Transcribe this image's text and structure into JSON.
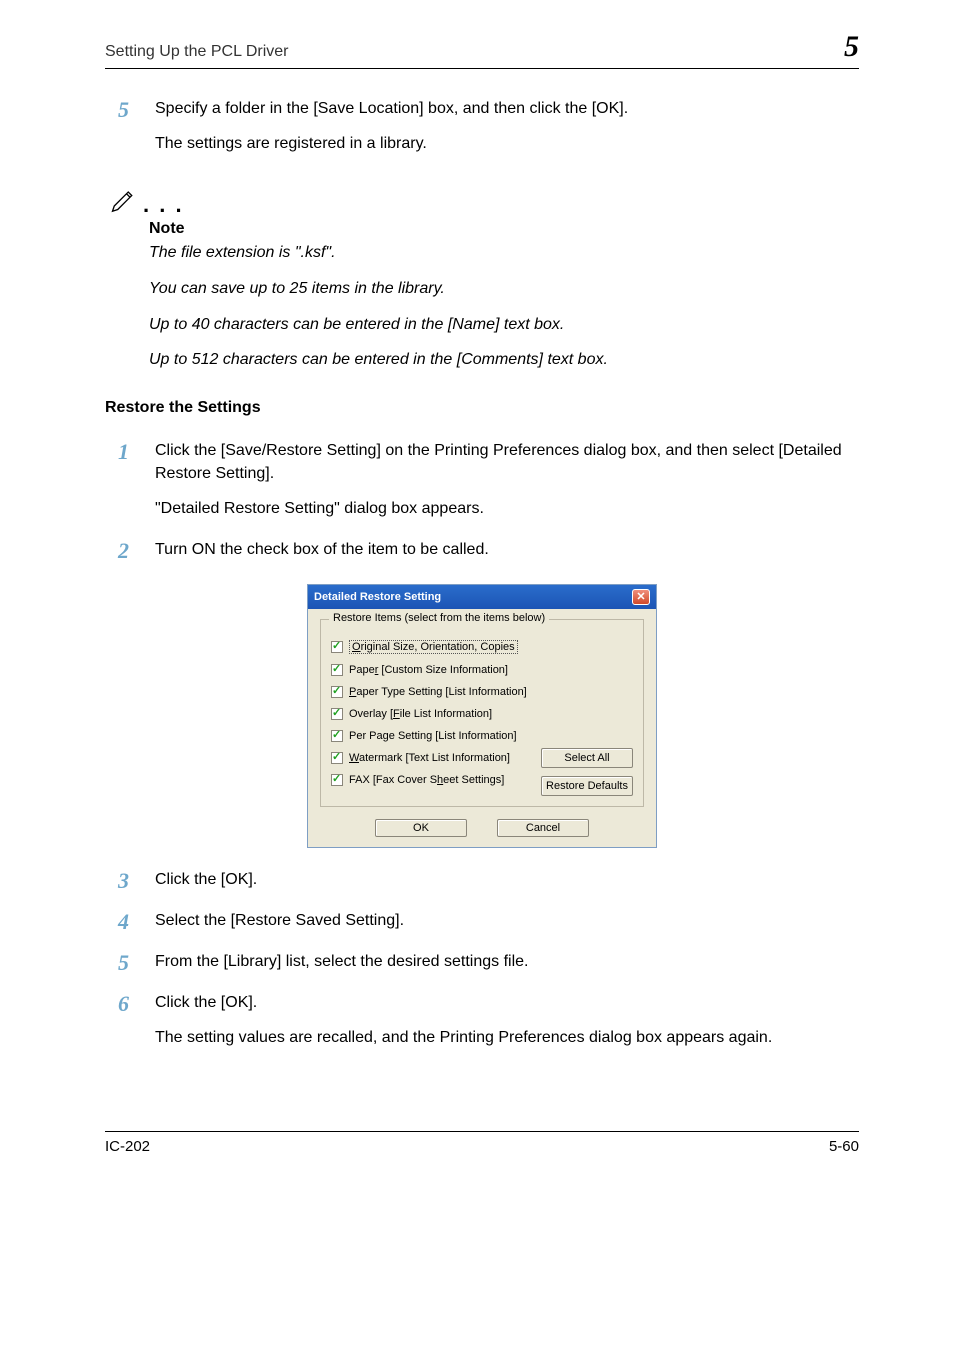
{
  "header": {
    "title": "Setting Up the PCL Driver",
    "chapter_number": "5"
  },
  "intro_step": {
    "num": "5",
    "line1": "Specify a folder in the [Save Location] box, and then click the [OK].",
    "line2": "The settings are registered in a library."
  },
  "note": {
    "label": "Note",
    "lines": [
      "The file extension is \".ksf\".",
      "You can save up to 25 items in the library.",
      "Up to 40 characters can be entered in the [Name] text box.",
      "Up to 512 characters can be entered in the [Comments] text box."
    ]
  },
  "section_heading": "Restore the Settings",
  "steps": [
    {
      "num": "1",
      "line1": "Click the [Save/Restore Setting] on the Printing Preferences dialog box, and then select [Detailed Restore Setting].",
      "line2": "\"Detailed Restore Setting\" dialog box appears."
    },
    {
      "num": "2",
      "line1": "Turn ON the check box of the item to be called."
    }
  ],
  "dialog": {
    "title": "Detailed Restore Setting",
    "group_legend": "Restore Items (select from the items below)",
    "checks": [
      {
        "label_pre": "",
        "key": "O",
        "label_post": "riginal Size, Orientation, Copies",
        "boxed": true
      },
      {
        "label_pre": "Pape",
        "key": "r",
        "label_post": " [Custom Size Information]"
      },
      {
        "label_pre": "",
        "key": "P",
        "label_post": "aper Type Setting [List Information]"
      },
      {
        "label_pre": "Overlay [",
        "key": "F",
        "label_post": "ile List Information]"
      },
      {
        "label_pre": "Per Pa",
        "key": "g",
        "label_post": "e Setting [List Information]"
      },
      {
        "label_pre": "",
        "key": "W",
        "label_post": "atermark [Text List Information]"
      },
      {
        "label_pre": "FAX [Fax Cover S",
        "key": "h",
        "label_post": "eet Settings]"
      }
    ],
    "select_all": "Select All",
    "restore_defaults": "Restore Defaults",
    "ok": "OK",
    "cancel": "Cancel"
  },
  "after_steps": [
    {
      "num": "3",
      "line1": "Click the [OK]."
    },
    {
      "num": "4",
      "line1": "Select the [Restore Saved Setting]."
    },
    {
      "num": "5",
      "line1": "From the [Library] list, select the desired settings file."
    },
    {
      "num": "6",
      "line1": "Click the [OK].",
      "line2": "The setting values are recalled, and the Printing Preferences dialog box appears again."
    }
  ],
  "footer": {
    "left": "IC-202",
    "right": "5-60"
  }
}
